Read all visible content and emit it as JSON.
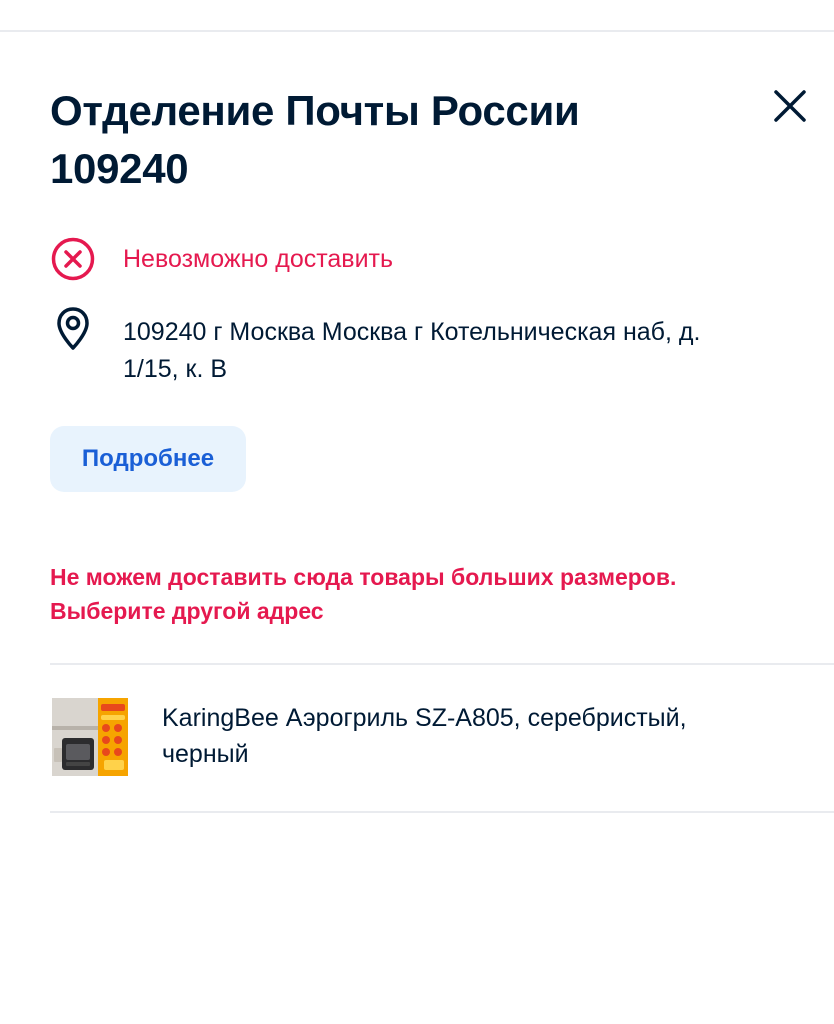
{
  "header": {
    "title_line1": "Отделение Почты России",
    "title_line2": "109240"
  },
  "status": {
    "text": "Невозможно доставить",
    "icon": "x-circle-icon",
    "color": "#e5194f"
  },
  "address": {
    "icon": "map-pin-icon",
    "line1": "109240 г Москва Москва г Котельническая наб, д.",
    "line2": "1/15, к. В"
  },
  "details_button": {
    "label": "Подробнее"
  },
  "warning": {
    "line1": "Не можем доставить сюда товары больших размеров.",
    "line2": "Выберите другой адрес"
  },
  "product": {
    "name_line1": "KaringBee Аэрогриль SZ-A805, серебристый,",
    "name_line2": "черный"
  },
  "colors": {
    "text_primary": "#001a34",
    "alert": "#e5194f",
    "link": "#1a5fd6",
    "button_bg": "#e8f3fd",
    "divider": "#e9ebef"
  }
}
